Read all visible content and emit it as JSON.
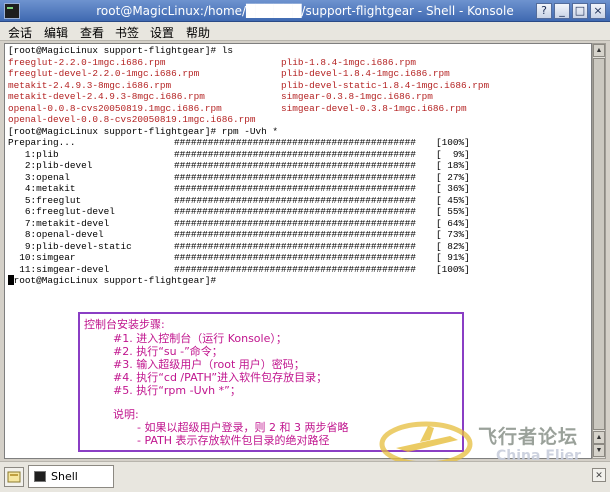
{
  "window": {
    "title": "root@MagicLinux:/home/██████/support-flightgear - Shell - Konsole",
    "controls": {
      "help": "?",
      "minimize": "_",
      "maximize": "□",
      "close": "×"
    }
  },
  "menu": [
    "会话",
    "编辑",
    "查看",
    "书签",
    "设置",
    "帮助"
  ],
  "terminal": {
    "prompt_ls": "[root@MagicLinux support-flightgear]# ls",
    "ls_left": [
      "freeglut-2.2.0-1mgc.i686.rpm",
      "freeglut-devel-2.2.0-1mgc.i686.rpm",
      "metakit-2.4.9.3-8mgc.i686.rpm",
      "metakit-devel-2.4.9.3-8mgc.i686.rpm",
      "openal-0.0.8-cvs20050819.1mgc.i686.rpm",
      "openal-devel-0.0.8-cvs20050819.1mgc.i686.rpm"
    ],
    "ls_right": [
      "plib-1.8.4-1mgc.i686.rpm",
      "plib-devel-1.8.4-1mgc.i686.rpm",
      "plib-devel-static-1.8.4-1mgc.i686.rpm",
      "simgear-0.3.8-1mgc.i686.rpm",
      "simgear-devel-0.3.8-1mgc.i686.rpm",
      ""
    ],
    "prompt_rpm": "[root@MagicLinux support-flightgear]# rpm -Uvh *",
    "progress_bar": "###########################################",
    "install_rows": [
      {
        "name": "Preparing...",
        "percent": "[100%]"
      },
      {
        "name": "   1:plib",
        "percent": "[  9%]"
      },
      {
        "name": "   2:plib-devel",
        "percent": "[ 18%]"
      },
      {
        "name": "   3:openal",
        "percent": "[ 27%]"
      },
      {
        "name": "   4:metakit",
        "percent": "[ 36%]"
      },
      {
        "name": "   5:freeglut",
        "percent": "[ 45%]"
      },
      {
        "name": "   6:freeglut-devel",
        "percent": "[ 55%]"
      },
      {
        "name": "   7:metakit-devel",
        "percent": "[ 64%]"
      },
      {
        "name": "   8:openal-devel",
        "percent": "[ 73%]"
      },
      {
        "name": "   9:plib-devel-static",
        "percent": "[ 82%]"
      },
      {
        "name": "  10:simgear",
        "percent": "[ 91%]"
      },
      {
        "name": "  11:simgear-devel",
        "percent": "[100%]"
      }
    ],
    "prompt_final": "[root@MagicLinux support-flightgear]# "
  },
  "note": {
    "heading": "控制台安装步骤:",
    "steps": [
      "#1. 进入控制台（运行 Konsole）；",
      "#2. 执行“su -”命令；",
      "#3. 输入超级用户（root 用户）密码；",
      "#4. 执行“cd /PATH”进入软件包存放目录；",
      "#5. 执行“rpm -Uvh *”；"
    ],
    "remark_label": "说明:",
    "remarks": [
      "- 如果以超级用户登录，则 2 和 3 两步省略",
      "- PATH 表示存放软件包目录的绝对路径"
    ]
  },
  "watermark": {
    "text": "飞行者论坛",
    "sub": "China Flier"
  },
  "tabbar": {
    "tab_label": "Shell"
  },
  "colors": {
    "prompt_text": "#000000",
    "rpm_files": "#b42323",
    "note_text": "#c0158e",
    "note_border": "#8a3ec4"
  }
}
